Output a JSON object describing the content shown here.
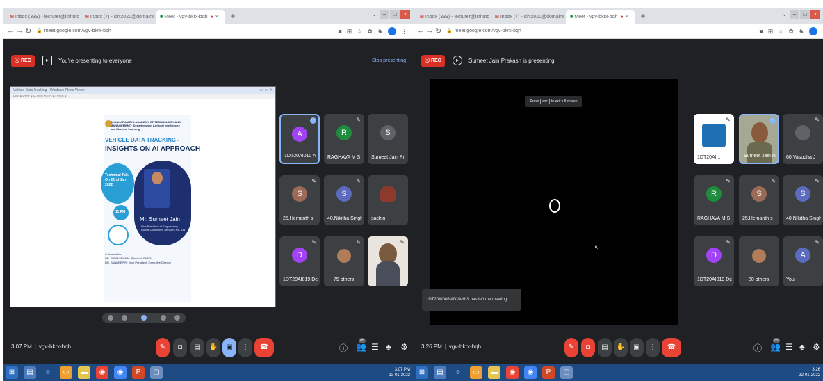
{
  "left": {
    "tabs": [
      {
        "label": "Inbox (339) - lecturer@istituto",
        "icon": "gmail-icon"
      },
      {
        "label": "Inbox (7) - sirr2020@domains",
        "icon": "gmail-icon"
      },
      {
        "label": "Meet - vgv-bkrx-bqh",
        "icon": "meet-icon"
      }
    ],
    "url": "meet.google.com/vgv-bkrx-bqh",
    "rec": "REC",
    "present_text": "You're presenting to everyone",
    "stop_presenting": "Stop presenting",
    "shared_window_title": "Vehicle Data Tracking - Windows Photo Viewer",
    "shared_menu": "File ▾  Print ▾  E-mail  Burn ▾  Open ▾",
    "poster": {
      "header": "SHANKARA ARYA ACADEMY OF TECHNOLOGY AND MANAGEMENT · Department of Artificial Intelligence and Machine Learning",
      "title1": "VEHICLE DATA TRACKING -",
      "title2": "INSIGHTS ON AI APPROACH",
      "event": "Technical Talk\nOn 22nd Jan\n2022",
      "time": "11 PM",
      "speaker": "Mr. Sumeet Jain",
      "speaker_role": "Vice President of Engineering\nGlobal Connected Services Pvt. Ltd",
      "coordinators": "In Association\nDR. R RAKSHANA · Principal, SAATM\nDR. SANDEEP R · Vice President, Executive Director"
    },
    "tiles": [
      {
        "initial": "A",
        "name": "1DT20AI010 AR...",
        "color": "#a142f4"
      },
      {
        "initial": "R",
        "name": "RAGHAVA M S",
        "color": "#1e8e3e"
      },
      {
        "initial": "S",
        "name": "Sumeet Jain Pr...",
        "color": "#5f6368"
      },
      {
        "initial": "S",
        "name": "25.Hemanth s",
        "color": "#9c6b57"
      },
      {
        "initial": "S",
        "name": "40.Nikitha Singh",
        "color": "#5c6bc0"
      },
      {
        "initial": "",
        "name": "sachin",
        "color": "#3c4043"
      },
      {
        "initial": "D",
        "name": "1DT20AI019 De...",
        "color": "#a142f4"
      },
      {
        "initial": "",
        "name": "75 others",
        "color": "#3c4043"
      },
      {
        "initial": "",
        "name": "",
        "color": "#3c4043"
      }
    ],
    "time": "3:07 PM",
    "meeting_code": "vgv-bkrx-bqh",
    "participants_badge": "85",
    "clock_time": "3:07 PM",
    "clock_date": "22-01-2022"
  },
  "right": {
    "tabs": [
      {
        "label": "Inbox (339) - lecturer@istituto",
        "icon": "gmail-icon"
      },
      {
        "label": "Inbox (7) - sirr2020@domains",
        "icon": "gmail-icon"
      },
      {
        "label": "Meet - vgv-bkrx-bqh",
        "icon": "meet-icon"
      }
    ],
    "url": "meet.google.com/vgv-bkrx-bqh",
    "rec": "REC",
    "present_text": "Sumeet Jain Prakash is presenting",
    "esc_hint_pre": "Press",
    "esc_key": "esc",
    "esc_hint_post": "to exit full screen",
    "toast": "1DT20AI006 ADVA H S has left the meeting",
    "tiles": [
      {
        "initial": "",
        "name": "1DT20AI...",
        "color": "#3c4043"
      },
      {
        "initial": "",
        "name": "Sumeet Jain P...",
        "color": "#3c4043"
      },
      {
        "initial": "",
        "name": "60.Vasudha J",
        "color": "#3c4043"
      },
      {
        "initial": "R",
        "name": "RAGHAVA M S",
        "color": "#1e8e3e"
      },
      {
        "initial": "S",
        "name": "25.Hemanth s",
        "color": "#9c6b57"
      },
      {
        "initial": "S",
        "name": "40.Nikitha Singh",
        "color": "#5c6bc0"
      },
      {
        "initial": "D",
        "name": "1DT20AI019 De...",
        "color": "#a142f4"
      },
      {
        "initial": "",
        "name": "80 others",
        "color": "#3c4043"
      },
      {
        "initial": "A",
        "name": "You",
        "color": "#5c6bc0"
      }
    ],
    "time": "3:26 PM",
    "meeting_code": "vgv-bkrx-bqh",
    "participants_badge": "85",
    "clock_time": "3:26",
    "clock_date": "22-01-2022"
  }
}
